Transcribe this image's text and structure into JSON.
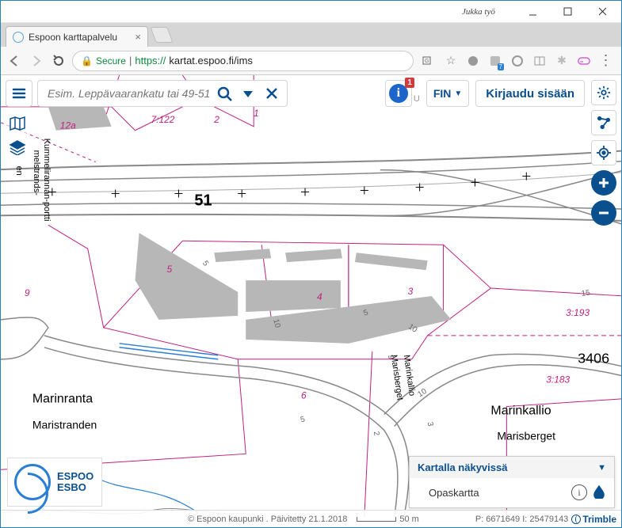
{
  "window": {
    "user_label": "Jukka työ"
  },
  "browser": {
    "tab_title": "Espoon karttapalvelu",
    "secure_label": "Secure",
    "url_prefix": "https://",
    "url": "kartat.espoo.fi/ims"
  },
  "app": {
    "search_placeholder": "Esim. Leppävaarankatu tai 49-51-",
    "info_badge": "1",
    "u_hint": "U",
    "lang": "FIN",
    "login": "Kirjaudu sisään"
  },
  "layers_panel": {
    "title": "Kartalla näkyvissä",
    "rows": [
      "Opaskartta"
    ]
  },
  "status": {
    "copyright": "© Espoon kaupunki . Päivitetty 21.1.2018",
    "scale_label": "50 m",
    "coords": "P: 6671649 I: 25479143",
    "vendor": "Trimble"
  },
  "logo": {
    "line1": "ESPOO",
    "line2": "ESBO"
  },
  "map": {
    "road_number": "51",
    "parcel_left": "3406",
    "parcels": [
      "7:122",
      "3:193",
      "3:183"
    ],
    "lots": [
      "12a",
      "2",
      "1",
      "5",
      "4",
      "3",
      "6",
      "9"
    ],
    "contours": [
      "5",
      "10",
      "5",
      "10",
      "5",
      "2",
      "3",
      "15"
    ],
    "street_vertical": "Kummelirannan-portti",
    "street_vertical_sub": "melstrands-",
    "street_vertical_suffix": "en",
    "street_diag": "Marinkallio",
    "street_diag_sub": "Marisberget",
    "places": {
      "left": "Marinranta",
      "left_sub": "Maristranden",
      "right": "Marinkallio",
      "right_sub": "Marisberget"
    }
  }
}
